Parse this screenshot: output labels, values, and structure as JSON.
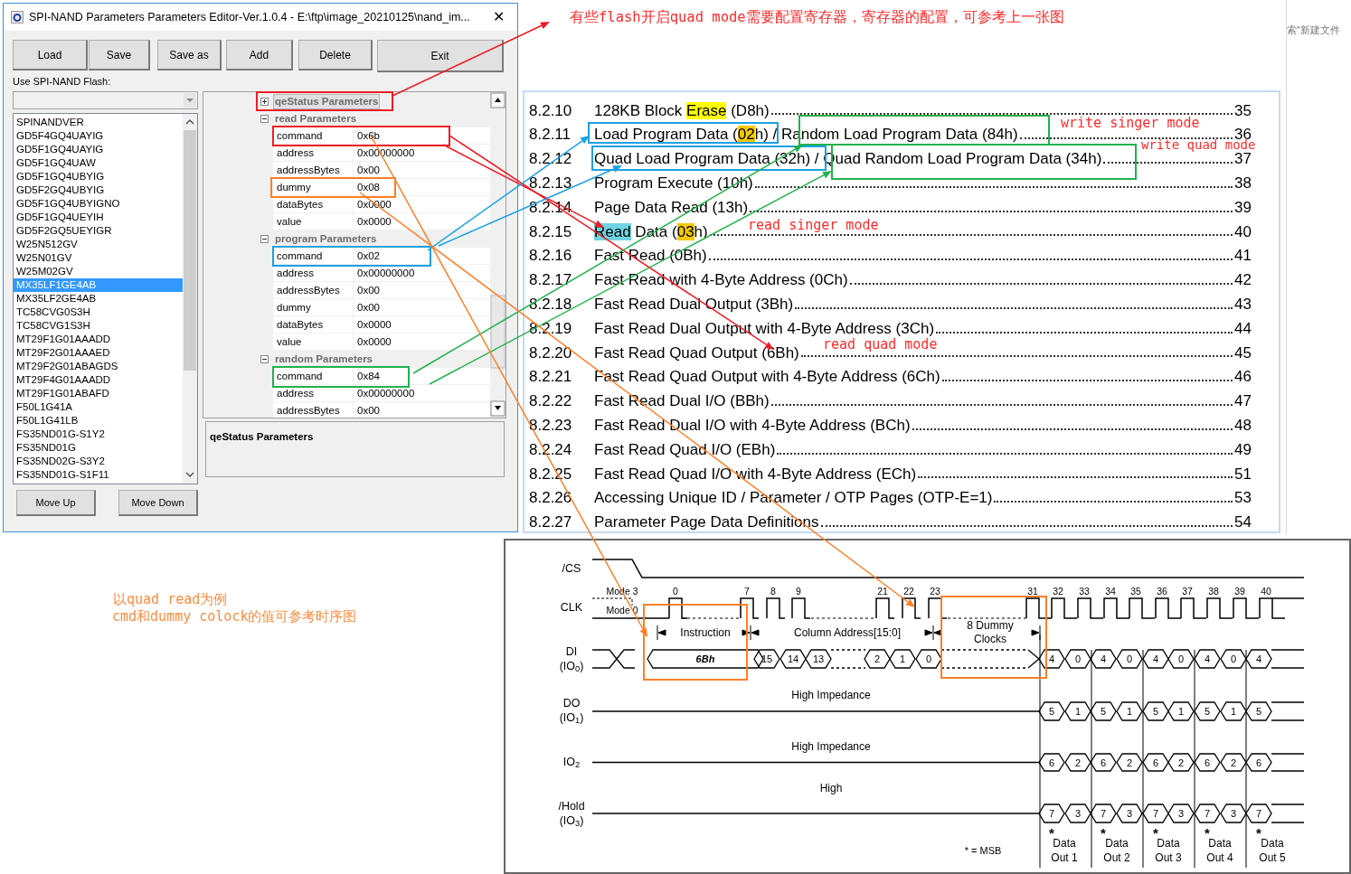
{
  "window": {
    "title": "SPI-NAND Parameters Parameters Editor-Ver.1.0.4 - E:\\ftp\\image_20210125\\nand_im...",
    "close_glyph": "✕",
    "toolbar": [
      "Load",
      "Save",
      "Save as",
      "Add",
      "Delete",
      "Exit"
    ],
    "flash_label": "Use SPI-NAND Flash:",
    "flash_list": [
      {
        "name": "SPINANDVER",
        "selected": false
      },
      {
        "name": "GD5F4GQ4UAYIG",
        "selected": false
      },
      {
        "name": "GD5F1GQ4UAYIG",
        "selected": false
      },
      {
        "name": "GD5F1GQ4UAW",
        "selected": false
      },
      {
        "name": "GD5F1GQ4UBYIG",
        "selected": false
      },
      {
        "name": "GD5F2GQ4UBYIG",
        "selected": false
      },
      {
        "name": "GD5F1GQ4UBYIGNO",
        "selected": false
      },
      {
        "name": "GD5F1GQ4UEYIH",
        "selected": false
      },
      {
        "name": "GD5F2GQ5UEYIGR",
        "selected": false
      },
      {
        "name": "W25N512GV",
        "selected": false
      },
      {
        "name": "W25N01GV",
        "selected": false
      },
      {
        "name": "W25M02GV",
        "selected": false
      },
      {
        "name": "MX35LF1GE4AB",
        "selected": true
      },
      {
        "name": "MX35LF2GE4AB",
        "selected": false
      },
      {
        "name": "TC58CVG0S3H",
        "selected": false
      },
      {
        "name": "TC58CVG1S3H",
        "selected": false
      },
      {
        "name": "MT29F1G01AAADD",
        "selected": false
      },
      {
        "name": "MT29F2G01AAAED",
        "selected": false
      },
      {
        "name": "MT29F2G01ABAGDS",
        "selected": false
      },
      {
        "name": "MT29F4G01AAADD",
        "selected": false
      },
      {
        "name": "MT29F1G01ABAFD",
        "selected": false
      },
      {
        "name": "F50L1G41A",
        "selected": false
      },
      {
        "name": "F50L1G41LB",
        "selected": false
      },
      {
        "name": "FS35ND01G-S1Y2",
        "selected": false
      },
      {
        "name": "FS35ND01G",
        "selected": false
      },
      {
        "name": "FS35ND02G-S3Y2",
        "selected": false
      },
      {
        "name": "FS35ND01G-S1F11",
        "selected": false
      }
    ],
    "property_grid": [
      {
        "name": "qeStatus Parameters",
        "expanded": false,
        "selected": true
      },
      {
        "name": "read Parameters",
        "expanded": true,
        "selected": false,
        "rows": [
          {
            "key": "command",
            "value": "0x6b"
          },
          {
            "key": "address",
            "value": "0x00000000"
          },
          {
            "key": "addressBytes",
            "value": "0x00"
          },
          {
            "key": "dummy",
            "value": "0x08"
          },
          {
            "key": "dataBytes",
            "value": "0x0000"
          },
          {
            "key": "value",
            "value": "0x0000"
          }
        ]
      },
      {
        "name": "program Parameters",
        "expanded": true,
        "selected": false,
        "rows": [
          {
            "key": "command",
            "value": "0x02"
          },
          {
            "key": "address",
            "value": "0x00000000"
          },
          {
            "key": "addressBytes",
            "value": "0x00"
          },
          {
            "key": "dummy",
            "value": "0x00"
          },
          {
            "key": "dataBytes",
            "value": "0x0000"
          },
          {
            "key": "value",
            "value": "0x0000"
          }
        ]
      },
      {
        "name": "random Parameters",
        "expanded": true,
        "selected": false,
        "rows": [
          {
            "key": "command",
            "value": "0x84"
          },
          {
            "key": "address",
            "value": "0x00000000"
          },
          {
            "key": "addressBytes",
            "value": "0x00"
          }
        ]
      }
    ],
    "description_title": "qeStatus Parameters",
    "bottom_buttons": [
      "Move Up",
      "Move Down"
    ]
  },
  "side_window": {
    "text": "索\"新建文件"
  },
  "toc": [
    {
      "number": "8.2.10",
      "parts": [
        {
          "text": "128KB Block "
        },
        {
          "text": "Erase",
          "color": "#ffff00"
        },
        {
          "text": " (D8h)"
        }
      ],
      "page": "35"
    },
    {
      "number": "8.2.11",
      "parts": [
        {
          "text": "Load Program Data ("
        },
        {
          "text": "02",
          "color": "#f5c800"
        },
        {
          "text": "h) / Random Load Program Data (84h)"
        }
      ],
      "page": "36"
    },
    {
      "number": "8.2.12",
      "parts": [
        {
          "text": "Quad Load Program Data (32h) / Quad Random Load Program Data (34h)"
        }
      ],
      "page": "37"
    },
    {
      "number": "8.2.13",
      "parts": [
        {
          "text": "Program Execute (10h)"
        }
      ],
      "page": "38"
    },
    {
      "number": "8.2.14",
      "parts": [
        {
          "text": "Page Data Read (13h)"
        }
      ],
      "page": "39"
    },
    {
      "number": "8.2.15",
      "parts": [
        {
          "text": "Read",
          "color": "#6fd3e3"
        },
        {
          "text": " Data ("
        },
        {
          "text": "03",
          "color": "#f5c800"
        },
        {
          "text": "h)"
        }
      ],
      "page": "40"
    },
    {
      "number": "8.2.16",
      "parts": [
        {
          "text": "Fast Read (0Bh)"
        }
      ],
      "page": "41"
    },
    {
      "number": "8.2.17",
      "parts": [
        {
          "text": "Fast Read with 4-Byte Address (0Ch)"
        }
      ],
      "page": "42"
    },
    {
      "number": "8.2.18",
      "parts": [
        {
          "text": "Fast Read Dual Output (3Bh)"
        }
      ],
      "page": "43"
    },
    {
      "number": "8.2.19",
      "parts": [
        {
          "text": "Fast Read Dual Output with 4-Byte Address (3Ch)"
        }
      ],
      "page": "44"
    },
    {
      "number": "8.2.20",
      "parts": [
        {
          "text": "Fast Read Quad Output (6Bh)"
        }
      ],
      "page": "45"
    },
    {
      "number": "8.2.21",
      "parts": [
        {
          "text": "Fast Read Quad Output with 4-Byte Address (6Ch)"
        }
      ],
      "page": "46"
    },
    {
      "number": "8.2.22",
      "parts": [
        {
          "text": "Fast Read Dual I/O (BBh)"
        }
      ],
      "page": "47"
    },
    {
      "number": "8.2.23",
      "parts": [
        {
          "text": "Fast Read Dual I/O with 4-Byte Address (BCh)"
        }
      ],
      "page": "48"
    },
    {
      "number": "8.2.24",
      "parts": [
        {
          "text": "Fast Read Quad I/O (EBh)"
        }
      ],
      "page": "49"
    },
    {
      "number": "8.2.25",
      "parts": [
        {
          "text": "Fast Read Quad I/O with 4-Byte Address (ECh)"
        }
      ],
      "page": "51"
    },
    {
      "number": "8.2.26",
      "parts": [
        {
          "text": "Accessing Unique ID / Parameter / OTP Pages (OTP-E=1)"
        }
      ],
      "page": "53"
    },
    {
      "number": "8.2.27",
      "parts": [
        {
          "text": "Parameter Page Data Definitions"
        }
      ],
      "page": "54"
    }
  ],
  "annotations": [
    {
      "text": "有些flash开启quad mode需要配置寄存器，寄存器的配置，可参考上一张图",
      "color": "#ff2a2a"
    },
    {
      "text": "write singer mode",
      "color": "#ff2a2a"
    },
    {
      "text": "write quad mode",
      "color": "#ff2a2a"
    },
    {
      "text": "read singer mode",
      "color": "#ff2a2a"
    },
    {
      "text": "read quad mode",
      "color": "#ff2a2a"
    },
    {
      "text": "以quad read为例",
      "color": "#ff8a3d"
    },
    {
      "text": "cmd和dummy colock的值可参考时序图",
      "color": "#ff8a3d"
    }
  ],
  "timing_diagram": {
    "signals": [
      {
        "label": "/CS"
      },
      {
        "label": "CLK"
      },
      {
        "label": "DI",
        "sub_label": "(IO$_{0}$)",
        "values": [
          "6Bh",
          "15",
          "14",
          "13",
          "2",
          "1",
          "0",
          "4",
          "0",
          "4",
          "0",
          "4",
          "0",
          "4",
          "0",
          "4"
        ]
      },
      {
        "label": "DO",
        "sub_label": "(IO$_{1}$)",
        "note": "High Impedance",
        "values": [
          "5",
          "1",
          "5",
          "1",
          "5",
          "1",
          "5",
          "1",
          "5"
        ]
      },
      {
        "label": "IO$_{2}$",
        "note": "High Impedance",
        "values": [
          "6",
          "2",
          "6",
          "2",
          "6",
          "2",
          "6",
          "2",
          "6"
        ]
      },
      {
        "label": "/Hold",
        "sub_label": "(IO$_{3}$)",
        "note": "High",
        "values": [
          "7",
          "3",
          "7",
          "3",
          "7",
          "3",
          "7",
          "3",
          "7"
        ]
      }
    ],
    "clock_numbers": [
      "0",
      "7",
      "8",
      "9",
      "21",
      "22",
      "23",
      "31",
      "32",
      "33",
      "34",
      "35",
      "36",
      "37",
      "38",
      "39",
      "40"
    ],
    "mode_labels": [
      "Mode 3",
      "Mode 0"
    ],
    "phases": [
      "Instruction",
      "Column Address[15:0]",
      "8 Dummy Clocks"
    ],
    "msb_marks": [
      "*",
      "*",
      "*",
      "*",
      "*"
    ],
    "data_outputs": [
      {
        "line1": "Data",
        "line2": "Out 1"
      },
      {
        "line1": "Data",
        "line2": "Out 2"
      },
      {
        "line1": "Data",
        "line2": "Out 3"
      },
      {
        "line1": "Data",
        "line2": "Out 4"
      },
      {
        "line1": "Data",
        "line2": "Out 5"
      }
    ],
    "legend": "* = MSB"
  }
}
